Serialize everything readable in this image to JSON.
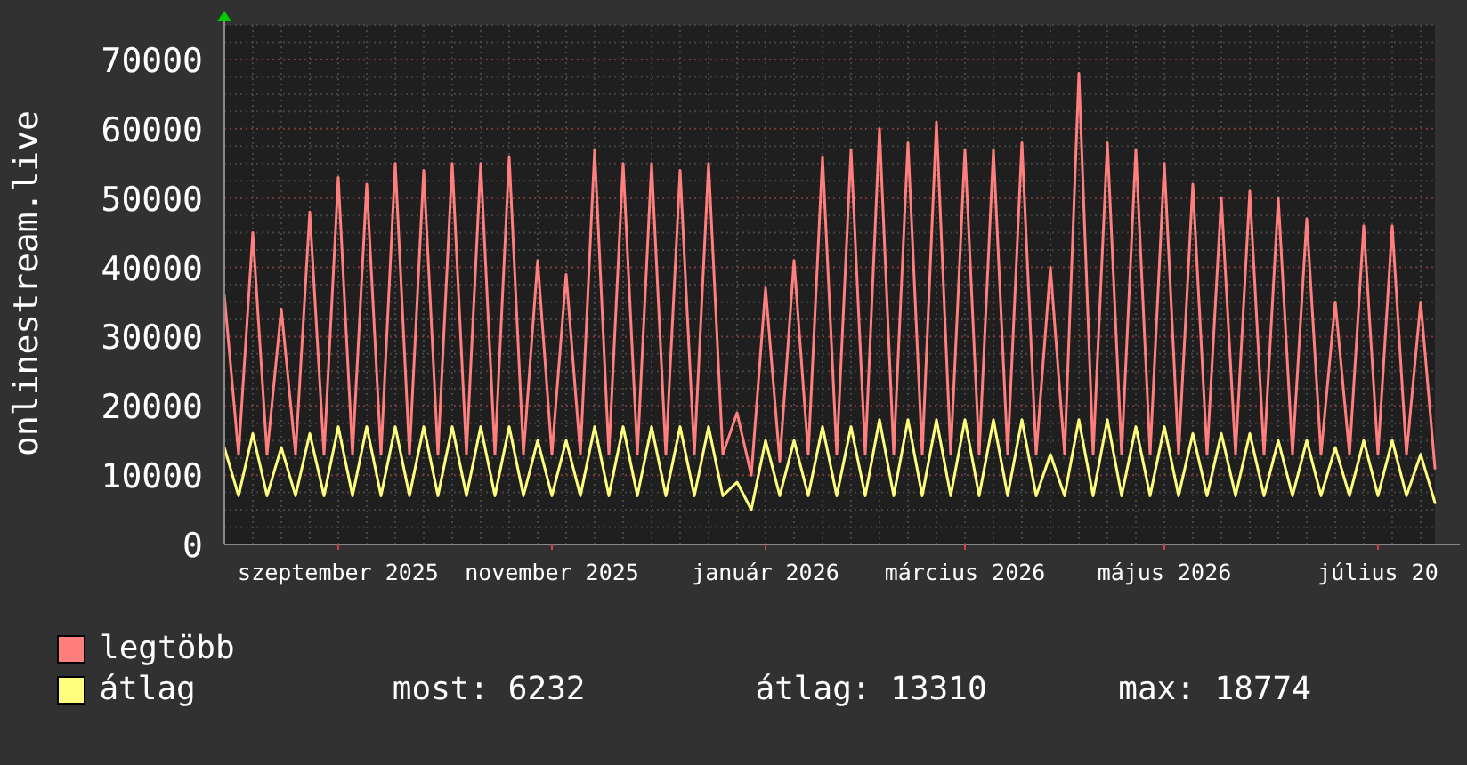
{
  "chart": {
    "chart_data": {
      "type": "line",
      "ylabel": "onlinestream.live",
      "grid": true,
      "ylim": [
        0,
        75000
      ],
      "categories": [
        null,
        null,
        null,
        null,
        null,
        null,
        null,
        null,
        "szeptember 2025",
        null,
        null,
        null,
        null,
        null,
        null,
        null,
        null,
        null,
        null,
        null,
        null,
        null,
        null,
        "november 2025",
        null,
        null,
        null,
        null,
        null,
        null,
        null,
        null,
        null,
        null,
        null,
        null,
        null,
        null,
        "január 2026",
        null,
        null,
        null,
        null,
        null,
        null,
        null,
        null,
        null,
        null,
        null,
        null,
        null,
        "március 2026",
        null,
        null,
        null,
        null,
        null,
        null,
        null,
        null,
        null,
        null,
        null,
        null,
        null,
        "május 2026",
        null,
        null,
        null,
        null,
        null,
        null,
        null,
        null,
        null,
        null,
        null,
        null,
        null,
        null,
        "július 20",
        null,
        null,
        null,
        null
      ],
      "yticks": [
        0,
        10000,
        20000,
        30000,
        40000,
        50000,
        60000,
        70000
      ],
      "series": [
        {
          "name": "legtöbb",
          "color": "#ff7f7f",
          "values": [
            36000,
            13000,
            45000,
            13000,
            34000,
            13000,
            48000,
            13000,
            53000,
            13000,
            52000,
            13000,
            55000,
            13000,
            54000,
            13000,
            55000,
            13000,
            55000,
            13000,
            56000,
            13000,
            41000,
            13000,
            39000,
            13000,
            57000,
            13000,
            55000,
            13000,
            55000,
            13000,
            54000,
            13000,
            55000,
            13000,
            19000,
            10000,
            37000,
            12000,
            41000,
            13000,
            56000,
            13000,
            57000,
            13000,
            60000,
            13000,
            58000,
            13000,
            61000,
            13000,
            57000,
            13000,
            57000,
            13000,
            58000,
            13000,
            40000,
            13000,
            68000,
            13000,
            58000,
            13000,
            57000,
            13000,
            55000,
            13000,
            52000,
            13000,
            50000,
            13000,
            51000,
            13000,
            50000,
            13000,
            47000,
            13000,
            35000,
            13000,
            46000,
            13000,
            46000,
            13000,
            35000,
            11000
          ]
        },
        {
          "name": "átlag",
          "color": "#ffff7f",
          "values": [
            14000,
            7000,
            16000,
            7000,
            14000,
            7000,
            16000,
            7000,
            17000,
            7000,
            17000,
            7000,
            17000,
            7000,
            17000,
            7000,
            17000,
            7000,
            17000,
            7000,
            17000,
            7000,
            15000,
            7000,
            15000,
            7000,
            17000,
            7000,
            17000,
            7000,
            17000,
            7000,
            17000,
            7000,
            17000,
            7000,
            9000,
            5000,
            15000,
            7000,
            15000,
            7000,
            17000,
            7000,
            17000,
            7000,
            18000,
            7000,
            18000,
            7000,
            18000,
            7000,
            18000,
            7000,
            18000,
            7000,
            18000,
            7000,
            13000,
            7000,
            18000,
            7000,
            18000,
            7000,
            17000,
            7000,
            17000,
            7000,
            16000,
            7000,
            16000,
            7000,
            16000,
            7000,
            15000,
            7000,
            15000,
            7000,
            14000,
            7000,
            15000,
            7000,
            15000,
            7000,
            13000,
            6000
          ]
        }
      ]
    }
  },
  "legend_stats": [
    "most: 6232",
    "átlag: 13310",
    "max: 18774"
  ]
}
